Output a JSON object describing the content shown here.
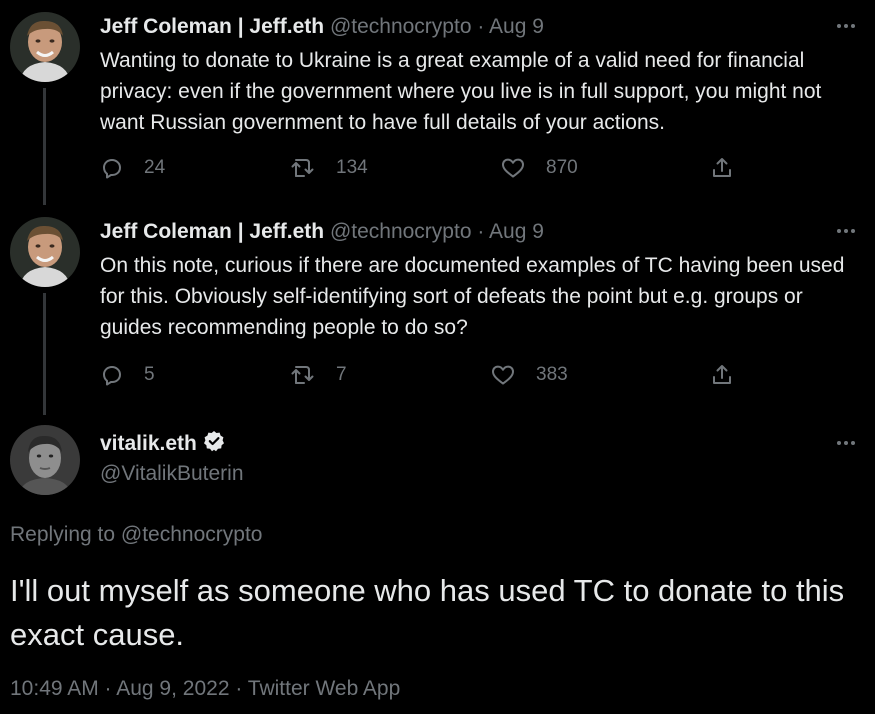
{
  "thread": [
    {
      "name": "Jeff Coleman | Jeff.eth",
      "handle": "@technocrypto",
      "separator": "·",
      "date": "Aug 9",
      "text": "Wanting to donate to Ukraine is a great example of a valid need for financial privacy: even if the government where you live is in full support, you might not want Russian government to have full details of your actions.",
      "replies": "24",
      "retweets": "134",
      "likes": "870"
    },
    {
      "name": "Jeff Coleman | Jeff.eth",
      "handle": "@technocrypto",
      "separator": "·",
      "date": "Aug 9",
      "text": "On this note, curious if there are documented examples of TC having been used for this. Obviously self-identifying sort of defeats the point but e.g. groups or guides recommending people to do so?",
      "replies": "5",
      "retweets": "7",
      "likes": "383"
    }
  ],
  "main_tweet": {
    "name": "vitalik.eth",
    "handle": "@VitalikButerin",
    "replying_prefix": "Replying to",
    "replying_to": "@technocrypto",
    "text": "I'll out myself as someone who has used TC to donate to this exact cause.",
    "meta": "10:49 AM · Aug 9, 2022 · Twitter Web App"
  },
  "icons": {
    "reply": "reply-icon",
    "retweet": "retweet-icon",
    "like": "heart-icon",
    "share": "share-icon",
    "more": "more-icon",
    "verified": "verified-badge-icon"
  },
  "colors": {
    "background": "#000000",
    "text": "#e7e9ea",
    "muted": "#71767b",
    "thread_line": "#333639"
  }
}
